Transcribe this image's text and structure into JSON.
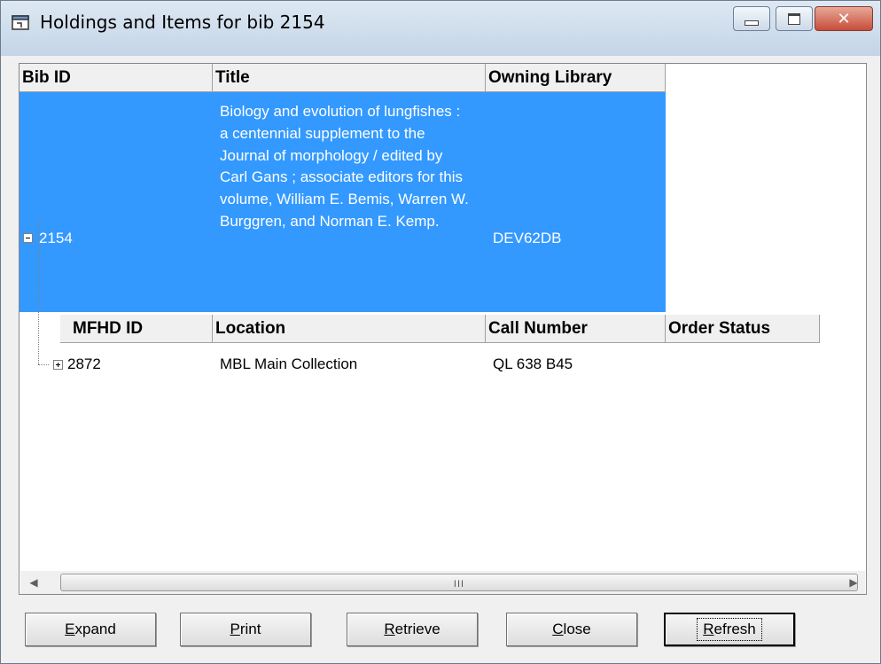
{
  "window": {
    "title": "Holdings and Items for bib 2154",
    "controls": {
      "minimize": "minimize",
      "maximize": "maximize",
      "close": "✕"
    }
  },
  "grid": {
    "bib_headers": [
      "Bib ID",
      "Title",
      "Owning Library"
    ],
    "bib_row": {
      "bib_id": "2154",
      "title": "Biology and evolution of lungfishes : a centennial supplement to the Journal of morphology / edited by Carl Gans ; associate editors for this volume, William E. Bemis, Warren W. Burggren, and Norman E. Kemp.",
      "owning_library": "DEV62DB",
      "expanded": true,
      "selected": true
    },
    "mfhd_headers": [
      "MFHD ID",
      "Location",
      "Call Number",
      "Order Status"
    ],
    "mfhd_rows": [
      {
        "mfhd_id": "2872",
        "location": "MBL Main Collection",
        "call_number": "QL 638 B45",
        "order_status": "",
        "expanded": false
      }
    ],
    "scrollbar": {
      "left_arrow": "◀",
      "right_arrow": "▶",
      "grip": "III"
    }
  },
  "buttons": {
    "expand": {
      "mnemonic": "E",
      "rest": "xpand"
    },
    "print": {
      "mnemonic": "P",
      "rest": "rint"
    },
    "retrieve": {
      "mnemonic": "R",
      "rest": "etrieve"
    },
    "close": {
      "mnemonic": "C",
      "rest": "lose"
    },
    "refresh": {
      "mnemonic": "R",
      "rest": "efresh",
      "default": true
    }
  },
  "colors": {
    "selection": "#3399ff",
    "header_bg": "#f0f0f0",
    "window_bg": "#f0f0f0"
  }
}
